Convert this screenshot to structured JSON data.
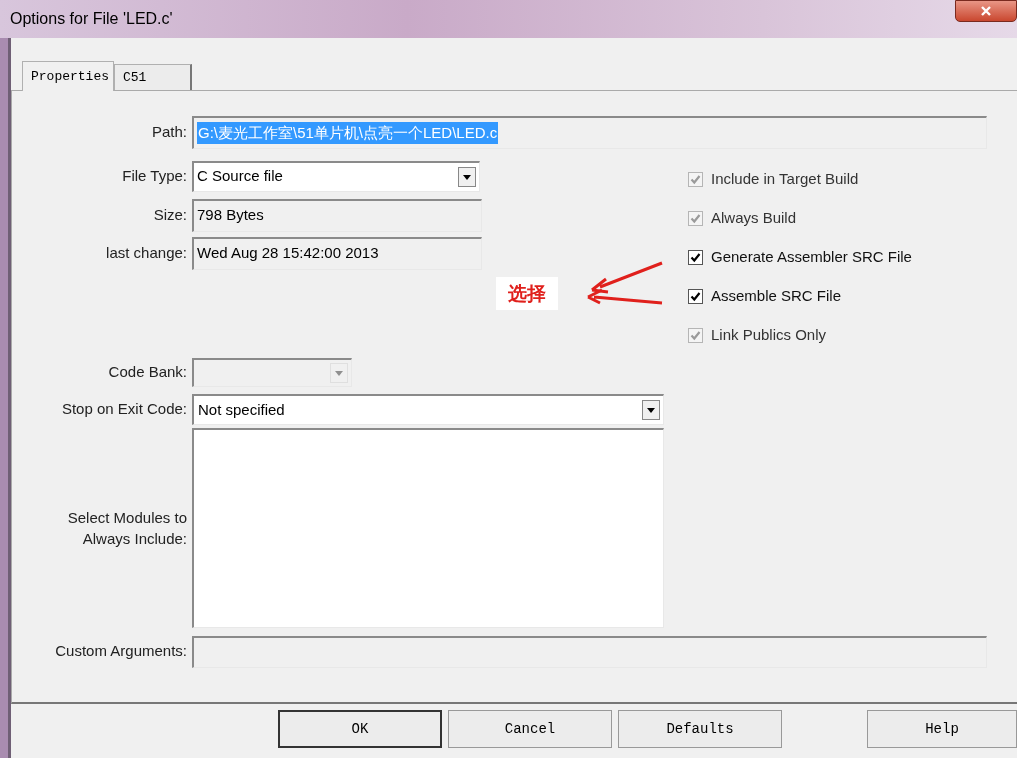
{
  "window": {
    "title": "Options for File 'LED.c'"
  },
  "tabs": [
    {
      "label": "Properties",
      "selected": true
    },
    {
      "label": "C51",
      "selected": false
    }
  ],
  "path": {
    "label": "Path:",
    "value": "G:\\麦光工作室\\51单片机\\点亮一个LED\\LED.c",
    "selected": true
  },
  "file_type": {
    "label": "File Type:",
    "value": "C Source file"
  },
  "size": {
    "label": "Size:",
    "value": "798 Bytes"
  },
  "last_change": {
    "label": "last change:",
    "value": "Wed Aug 28 15:42:00 2013"
  },
  "options": [
    {
      "label": "Include in Target Build",
      "checked": true,
      "disabled": true
    },
    {
      "label": "Always Build",
      "checked": true,
      "disabled": true
    },
    {
      "label": "Generate Assembler SRC File",
      "checked": true,
      "disabled": false
    },
    {
      "label": "Assemble SRC File",
      "checked": true,
      "disabled": false
    },
    {
      "label": "Link Publics Only",
      "checked": true,
      "disabled": true
    }
  ],
  "annotation": {
    "text": "选择"
  },
  "code_bank": {
    "label": "Code Bank:",
    "disabled": true
  },
  "stop_on_exit": {
    "label": "Stop on Exit Code:",
    "value": "Not specified"
  },
  "modules": {
    "label": "Select Modules to Always Include:"
  },
  "custom_arguments": {
    "label": "Custom Arguments:"
  },
  "buttons": [
    {
      "label": "OK",
      "default": true
    },
    {
      "label": "Cancel",
      "default": false
    },
    {
      "label": "Defaults",
      "default": false
    },
    {
      "label": "Help",
      "default": false
    }
  ]
}
